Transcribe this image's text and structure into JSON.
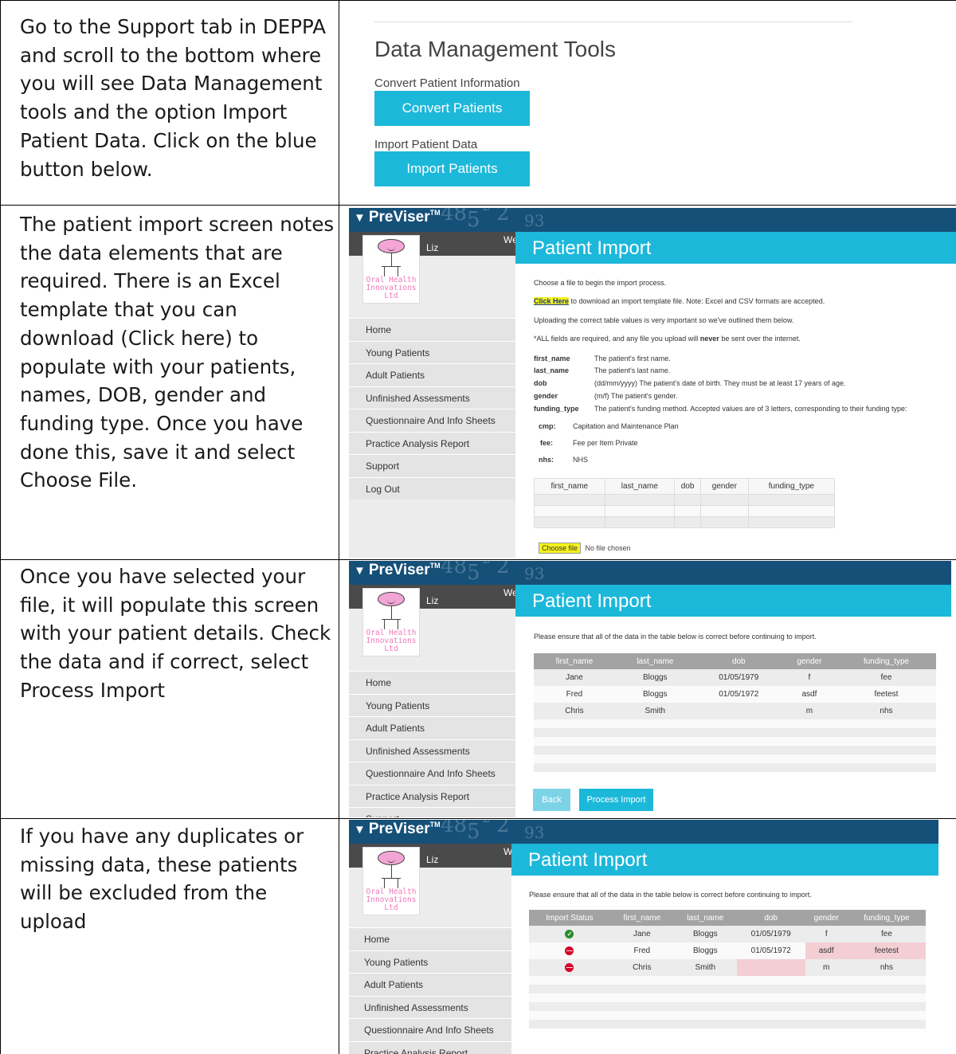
{
  "steps": [
    {
      "text": "Go to the Support tab in DEPPA and scroll to the bottom where you will see Data Management tools and the option Import Patient Data.  Click on the blue button below."
    },
    {
      "text": "The patient import screen notes the data elements that are required.  There is an Excel template that you can download (Click here) to populate with your patients, names, DOB, gender and funding type.  Once you have done this, save it and select Choose File."
    },
    {
      "text": "Once you have selected your file, it will populate this screen with your patient details.  Check the data and if correct, select Process Import"
    },
    {
      "text": "If you have any duplicates or missing data, these patients will be excluded from the upload"
    }
  ],
  "dmt": {
    "title": "Data Management Tools",
    "convert_label": "Convert Patient Information",
    "convert_button": "Convert Patients",
    "import_label": "Import Patient Data",
    "import_button": "Import Patients"
  },
  "app": {
    "brand": "PreViser",
    "tm": "TM",
    "deco": [
      "48",
      "5",
      "-2",
      "2",
      "93"
    ],
    "welcome": "Welcome,",
    "user": "Liz",
    "logo_lines": [
      "Oral Health",
      "Innovations",
      "Ltd"
    ],
    "nav": [
      "Home",
      "Young Patients",
      "Adult Patients",
      "Unfinished Assessments",
      "Questionnaire And Info Sheets",
      "Practice Analysis Report",
      "Support",
      "Log Out"
    ],
    "page_title": "Patient Import",
    "colors": {
      "topbar": "#155079",
      "accent": "#1cb8da",
      "sidebar_dark": "#4a4a4a",
      "error": "#d6002a",
      "ok": "#2b8a2b",
      "error_bg": "#f3cfd4"
    }
  },
  "import1": {
    "choose_text": "Choose a file to begin the import process.",
    "click_here": "Click Here",
    "download_text": " to download an import template file. Note: Excel and CSV formats are accepted.",
    "values_text": "Uploading the correct table values is very important so we've outlined them below.",
    "required_pre": "*ALL fields are required, and any file you upload will ",
    "required_bold": "never",
    "required_post": " be sent over the internet.",
    "fields": [
      {
        "name": "first_name",
        "desc": "The patient's first name."
      },
      {
        "name": "last_name",
        "desc": "The patient's last name."
      },
      {
        "name": "dob",
        "desc": "(dd/mm/yyyy) The patient's date of birth. They must be at least 17 years of age."
      },
      {
        "name": "gender",
        "desc": "(m/f) The patient's gender."
      },
      {
        "name": "funding_type",
        "desc": "The patient's funding method. Accepted values are of 3 letters, corresponding to their funding type:"
      }
    ],
    "funding": [
      {
        "code": "cmp:",
        "desc": "Capitation and Maintenance Plan"
      },
      {
        "code": "fee:",
        "desc": "Fee per Item Private"
      },
      {
        "code": "nhs:",
        "desc": "NHS"
      }
    ],
    "template_headers": [
      "first_name",
      "last_name",
      "dob",
      "gender",
      "funding_type"
    ],
    "choose_file": "Choose file",
    "no_file": "No file chosen"
  },
  "import2": {
    "ensure_text": "Please ensure that all of the data in the table below is correct before continuing to import.",
    "headers": [
      "first_name",
      "last_name",
      "dob",
      "gender",
      "funding_type"
    ],
    "rows": [
      [
        "Jane",
        "Bloggs",
        "01/05/1979",
        "f",
        "fee"
      ],
      [
        "Fred",
        "Bloggs",
        "01/05/1972",
        "asdf",
        "feetest"
      ],
      [
        "Chris",
        "Smith",
        "",
        "m",
        "nhs"
      ]
    ],
    "back": "Back",
    "process": "Process Import"
  },
  "import3": {
    "ensure_text": "Please ensure that all of the data in the table below is correct before continuing to import.",
    "headers": [
      "Import Status",
      "first_name",
      "last_name",
      "dob",
      "gender",
      "funding_type"
    ],
    "rows": [
      {
        "status": "ok",
        "cells": [
          "Jane",
          "Bloggs",
          "01/05/1979",
          "f",
          "fee"
        ]
      },
      {
        "status": "error",
        "cells": [
          "Fred",
          "Bloggs",
          "01/05/1972",
          "asdf",
          "feetest"
        ]
      },
      {
        "status": "error",
        "cells": [
          "Chris",
          "Smith",
          "",
          "m",
          "nhs"
        ]
      }
    ]
  }
}
